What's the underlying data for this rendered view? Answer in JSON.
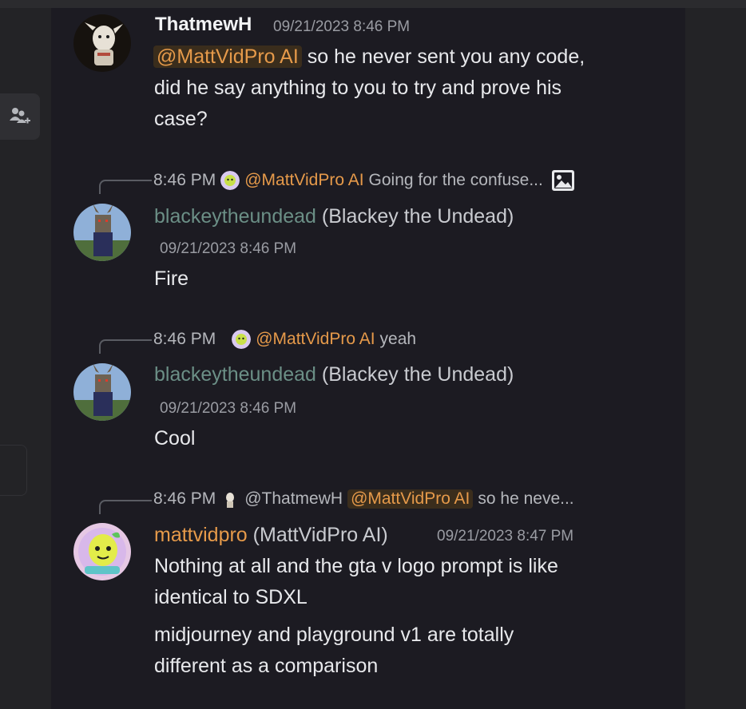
{
  "messages": [
    {
      "author": "ThatmewH",
      "timestamp": "09/21/2023 8:46 PM",
      "mention": "@MattVidPro AI",
      "lines": [
        "so he never sent you any code,",
        "did he say anything to you to try and prove his",
        "case?"
      ]
    },
    {
      "reply": {
        "time": "8:46 PM",
        "mention": "@MattVidPro AI",
        "text": "Going for the confuse..."
      },
      "username": "blackeytheundead",
      "display": "(Blackey the Undead)",
      "timestamp": "09/21/2023 8:46 PM",
      "text": "Fire"
    },
    {
      "reply": {
        "time": "8:46 PM",
        "mention": "@MattVidPro AI",
        "text": "yeah"
      },
      "username": "blackeytheundead",
      "display": "(Blackey the Undead)",
      "timestamp": "09/21/2023 8:46 PM",
      "text": "Cool"
    },
    {
      "reply": {
        "time": "8:46 PM",
        "author": "@ThatmewH",
        "mention": "@MattVidPro AI",
        "text": "so he neve..."
      },
      "username": "mattvidpro",
      "display": "(MattVidPro AI)",
      "timestamp": "09/21/2023 8:47 PM",
      "lines": [
        "Nothing at all and the gta v logo prompt is like",
        "identical to SDXL",
        "midjourney and playground v1 are totally",
        "different as a comparison"
      ]
    }
  ],
  "icons": {
    "rail": "add-member-icon",
    "reply_attachment": "image-icon"
  },
  "colors": {
    "background": "#1c1b22",
    "mention": "#e69a4a",
    "username_green": "#6b8f86"
  }
}
